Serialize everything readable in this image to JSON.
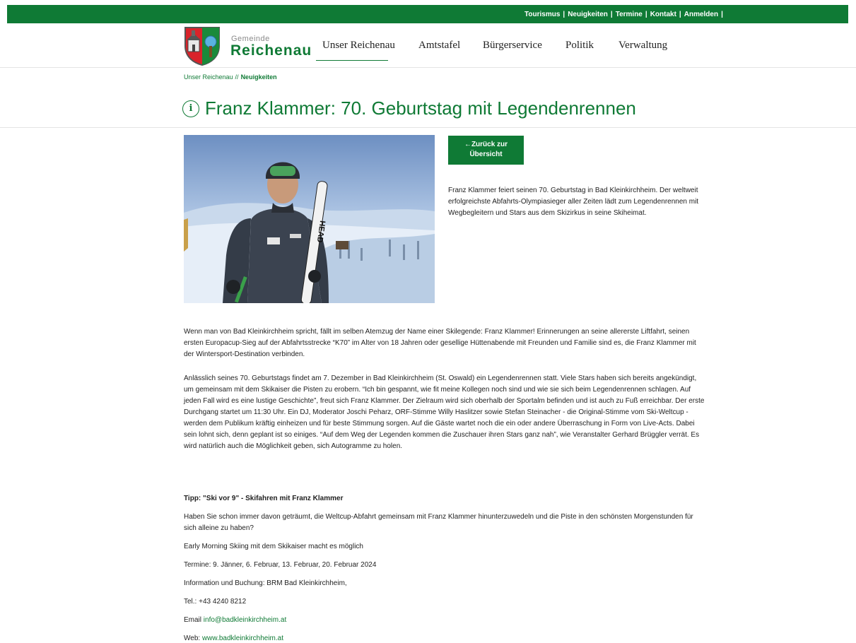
{
  "topbar": {
    "links": [
      "Tourismus",
      "Neuigkeiten",
      "Termine",
      "Kontakt",
      "Anmelden"
    ],
    "separator": "|"
  },
  "logo": {
    "small": "Gemeinde",
    "big": "Reichenau"
  },
  "nav": {
    "items": [
      "Unser Reichenau",
      "Amtstafel",
      "Bürgerservice",
      "Politik",
      "Verwaltung"
    ],
    "active": "Unser Reichenau"
  },
  "breadcrumb": {
    "parent": "Unser Reichenau",
    "separator": "//",
    "current": "Neuigkeiten"
  },
  "article": {
    "title": "Franz Klammer: 70. Geburtstag mit Legendenrennen",
    "back_button": [
      "←Zurück zur",
      "Übersicht"
    ],
    "intro": "Franz Klammer feiert seinen 70. Geburtstag in Bad Kleinkirchheim. Der weltweit erfolgreichste Abfahrts-Olympiasieger aller Zeiten lädt zum Legendenrennen mit Wegbegleitern und Stars aus dem Skizirkus in seine Skiheimat.",
    "paragraph1": "Wenn man von Bad Kleinkirchheim spricht, fällt im selben Atemzug der Name einer Skilegende: Franz Klammer! Erinnerungen an seine allererste Liftfahrt, seinen ersten Europacup-Sieg auf der Abfahrtsstrecke “K70” im Alter von 18 Jahren oder gesellige Hüttenabende mit Freunden und Familie sind es, die Franz Klammer mit der Wintersport-Destination verbinden.",
    "paragraph2": "Anlässlich seines 70. Geburtstags findet am 7. Dezember in Bad Kleinkirchheim (St. Oswald) ein Legendenrennen statt. Viele Stars haben sich bereits angekündigt, um gemeinsam mit dem Skikaiser die Pisten zu erobern. “Ich bin gespannt, wie fit meine Kollegen noch sind und wie sie sich beim Legendenrennen schlagen. Auf jeden Fall wird es eine lustige Geschichte”, freut sich Franz Klammer. Der Zielraum wird sich oberhalb der Sportalm befinden und ist auch zu Fuß erreichbar. Der erste Durchgang startet um 11:30 Uhr. Ein DJ, Moderator Joschi Peharz, ORF-Stimme Willy Haslitzer sowie Stefan Steinacher - die Original-Stimme vom Ski-Weltcup - werden dem Publikum kräftig einheizen und für beste Stimmung sorgen. Auf die Gäste wartet noch die ein oder andere Überraschung in Form von Live-Acts. Dabei sein lohnt sich, denn geplant ist so einiges. “Auf dem Weg der Legenden kommen die Zuschauer ihren Stars ganz nah”, wie Veranstalter Gerhard Brüggler verrät. Es wird natürlich auch die Möglichkeit geben, sich Autogramme zu holen."
  },
  "tip": {
    "title": "Tipp: \"Ski vor 9\" - Skifahren mit Franz Klammer",
    "question": "Haben Sie schon immer davon geträumt, die Weltcup-Abfahrt gemeinsam mit Franz Klammer hinunterzuwedeln und die Piste in den schönsten Morgenstunden für sich alleine zu haben?",
    "subtitle": "Early Morning Skiing mit dem Skikaiser macht es möglich",
    "dates": "Termine: 9. Jänner, 6. Februar, 13. Februar, 20. Februar 2024",
    "booking": "Information und Buchung: BRM Bad Kleinkirchheim,",
    "phone": "Tel.: +43 4240 8212",
    "email_label": "Email",
    "email": "info@badkleinkirchheim.at",
    "web_label": "Web:",
    "web": "www.badkleinkirchheim.at"
  },
  "hero_image_logo_text": "HEAD",
  "colors": {
    "primary_green": "#0f7a35"
  }
}
